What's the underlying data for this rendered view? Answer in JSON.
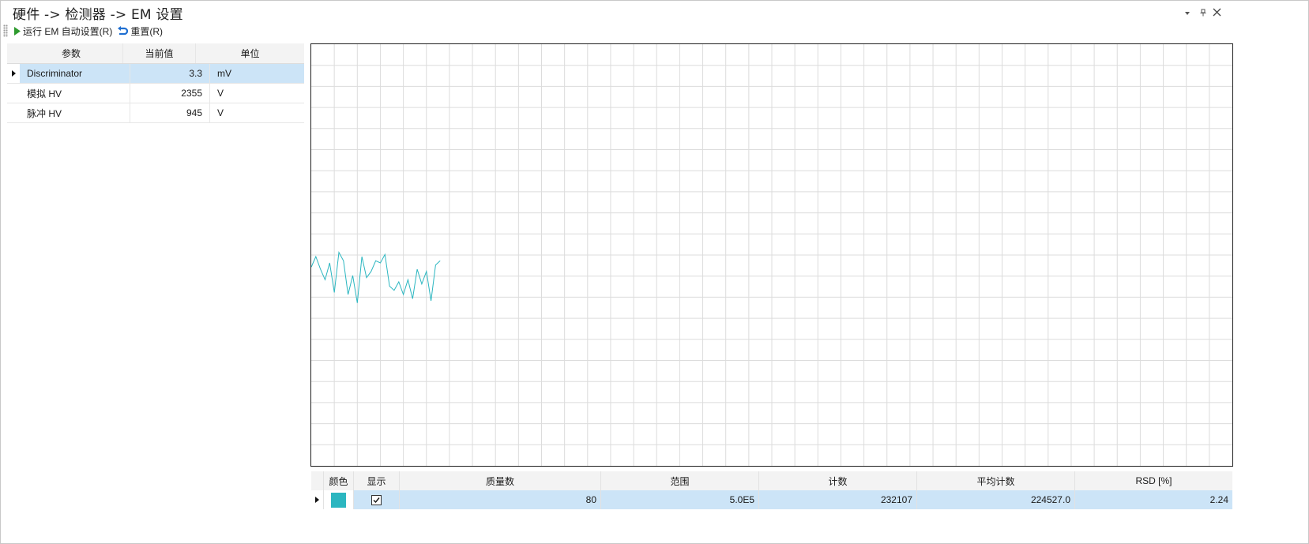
{
  "window": {
    "title": "硬件 -> 检测器 -> EM 设置"
  },
  "toolbar": {
    "run_label": "运行 EM 自动设置(R)",
    "reset_label": "重置(R)"
  },
  "param_table": {
    "headers": [
      "参数",
      "当前值",
      "单位"
    ],
    "rows": [
      {
        "name": "Discriminator",
        "value": "3.3",
        "unit": "mV"
      },
      {
        "name": "模拟 HV",
        "value": "2355",
        "unit": "V"
      },
      {
        "name": "脉冲 HV",
        "value": "945",
        "unit": "V"
      }
    ]
  },
  "chart_data": {
    "type": "line",
    "title": "",
    "xlabel": "",
    "ylabel": "",
    "grid": true,
    "color": "#2bb6c0",
    "x": [
      0,
      1,
      2,
      3,
      4,
      5,
      6,
      7,
      8,
      9,
      10,
      11,
      12,
      13,
      14,
      15,
      16,
      17,
      18,
      19,
      20,
      21,
      22,
      23,
      24,
      25,
      26,
      27,
      28
    ],
    "values": [
      0.4,
      0.9,
      0.3,
      -0.2,
      0.6,
      -0.8,
      1.1,
      0.7,
      -0.9,
      0.0,
      -1.3,
      0.9,
      -0.1,
      0.2,
      0.7,
      0.6,
      1.0,
      -0.5,
      -0.7,
      -0.3,
      -0.9,
      -0.2,
      -1.1,
      0.3,
      -0.4,
      0.2,
      -1.2,
      0.5,
      0.7
    ],
    "xlim": [
      0,
      200
    ],
    "ylim": [
      -10,
      10
    ]
  },
  "result_table": {
    "headers": [
      "颜色",
      "显示",
      "质量数",
      "范围",
      "计数",
      "平均计数",
      "RSD [%]"
    ],
    "rows": [
      {
        "color": "#2bb6c0",
        "show": true,
        "mass": "80",
        "range": "5.0E5",
        "count": "232107",
        "avg": "224527.0",
        "rsd": "2.24"
      }
    ]
  }
}
